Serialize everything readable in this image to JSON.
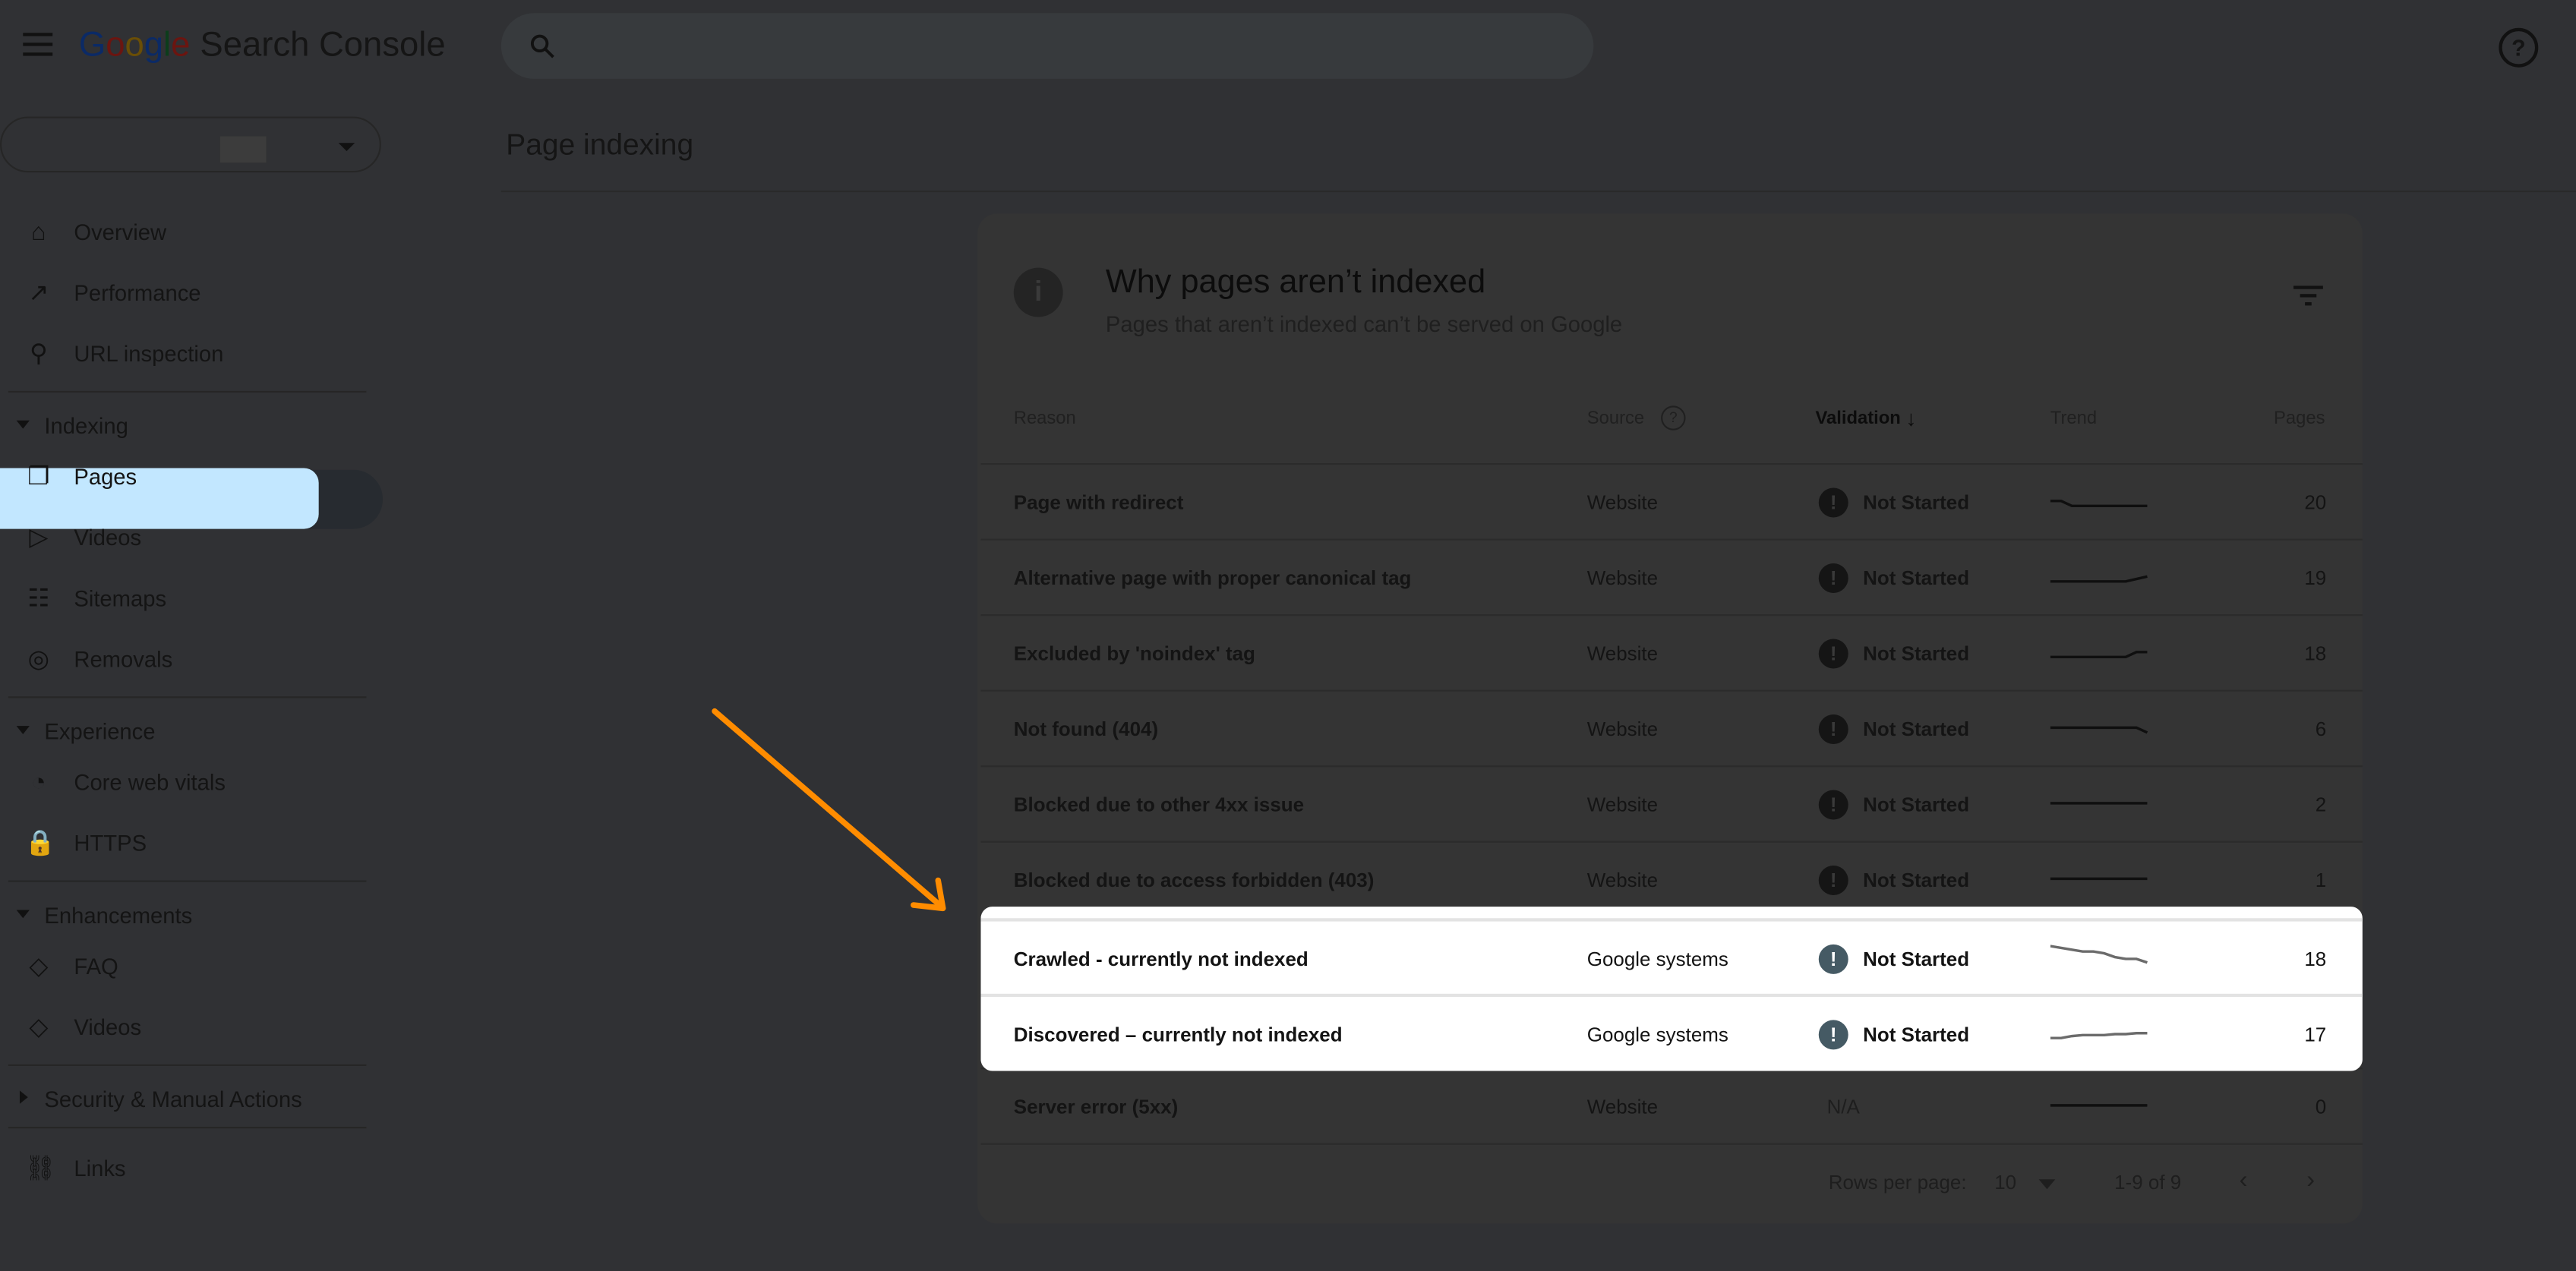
{
  "header": {
    "app_name_brand": "Google",
    "app_name_product": "Search Console",
    "search_placeholder": "",
    "help_icon": "?"
  },
  "property_selector": {
    "value": ""
  },
  "sidebar": {
    "items_top": [
      {
        "label": "Overview",
        "icon": "home-icon"
      },
      {
        "label": "Performance",
        "icon": "trending-up-icon"
      },
      {
        "label": "URL inspection",
        "icon": "search-icon"
      }
    ],
    "sections": [
      {
        "label": "Indexing",
        "expanded": true,
        "items": [
          {
            "label": "Pages",
            "icon": "pages-icon",
            "selected": true
          },
          {
            "label": "Videos",
            "icon": "video-icon"
          },
          {
            "label": "Sitemaps",
            "icon": "sitemap-icon"
          },
          {
            "label": "Removals",
            "icon": "eye-off-icon"
          }
        ]
      },
      {
        "label": "Experience",
        "expanded": true,
        "items": [
          {
            "label": "Core web vitals",
            "icon": "gauge-icon"
          },
          {
            "label": "HTTPS",
            "icon": "lock-icon"
          }
        ]
      },
      {
        "label": "Enhancements",
        "expanded": true,
        "items": [
          {
            "label": "FAQ",
            "icon": "layers-icon"
          },
          {
            "label": "Videos",
            "icon": "layers-icon"
          }
        ]
      },
      {
        "label": "Security & Manual Actions",
        "expanded": false,
        "items": []
      }
    ],
    "items_bottom": [
      {
        "label": "Links",
        "icon": "links-icon"
      }
    ]
  },
  "page": {
    "title": "Page indexing"
  },
  "card": {
    "title": "Why pages aren’t indexed",
    "subtitle": "Pages that aren’t indexed can’t be served on Google",
    "columns": {
      "reason": "Reason",
      "source": "Source",
      "validation": "Validation",
      "trend": "Trend",
      "pages": "Pages"
    },
    "rows": [
      {
        "reason": "Page with redirect",
        "source": "Website",
        "validation": "Not Started",
        "pages": "20",
        "trend": [
          22,
          22,
          21,
          21,
          21,
          21,
          21,
          21,
          21,
          21
        ]
      },
      {
        "reason": "Alternative page with proper canonical tag",
        "source": "Website",
        "validation": "Not Started",
        "pages": "19",
        "trend": [
          17,
          17,
          17,
          17,
          17,
          17,
          17,
          17,
          18,
          19
        ]
      },
      {
        "reason": "Excluded by 'noindex' tag",
        "source": "Website",
        "validation": "Not Started",
        "pages": "18",
        "trend": [
          17,
          17,
          17,
          17,
          17,
          17,
          17,
          17,
          18,
          18
        ]
      },
      {
        "reason": "Not found (404)",
        "source": "Website",
        "validation": "Not Started",
        "pages": "6",
        "trend": [
          7,
          7,
          7,
          7,
          7,
          7,
          7,
          7,
          7,
          6
        ]
      },
      {
        "reason": "Blocked due to other 4xx issue",
        "source": "Website",
        "validation": "Not Started",
        "pages": "2",
        "trend": [
          2,
          2,
          2,
          2,
          2,
          2,
          2,
          2,
          2,
          2
        ]
      },
      {
        "reason": "Blocked due to access forbidden (403)",
        "source": "Website",
        "validation": "Not Started",
        "pages": "1",
        "trend": [
          1,
          1,
          1,
          1,
          1,
          1,
          1,
          1,
          1,
          1
        ]
      },
      {
        "reason": "Crawled - currently not indexed",
        "source": "Google systems",
        "validation": "Not Started",
        "pages": "18",
        "highlighted": true,
        "trend": [
          28,
          27,
          26,
          25,
          25,
          24,
          22,
          21,
          21,
          19
        ]
      },
      {
        "reason": "Discovered – currently not indexed",
        "source": "Google systems",
        "validation": "Not Started",
        "pages": "17",
        "highlighted": true,
        "trend": [
          12,
          12,
          14,
          15,
          15,
          15,
          16,
          16,
          17,
          17
        ]
      },
      {
        "reason": "Server error (5xx)",
        "source": "Website",
        "validation": "N/A",
        "pages": "0",
        "trend": [
          0,
          0,
          0,
          0,
          0,
          0,
          0,
          0,
          0,
          0
        ]
      }
    ],
    "footer": {
      "rows_per_page_label": "Rows per page:",
      "rows_per_page": "10",
      "range": "1-9 of 9"
    }
  },
  "annotation": {
    "arrow_color": "#ff8c00"
  },
  "colors": {
    "highlight": "#ffffff",
    "selected_nav": "#c2e7ff",
    "status_icon": "#455a64"
  }
}
